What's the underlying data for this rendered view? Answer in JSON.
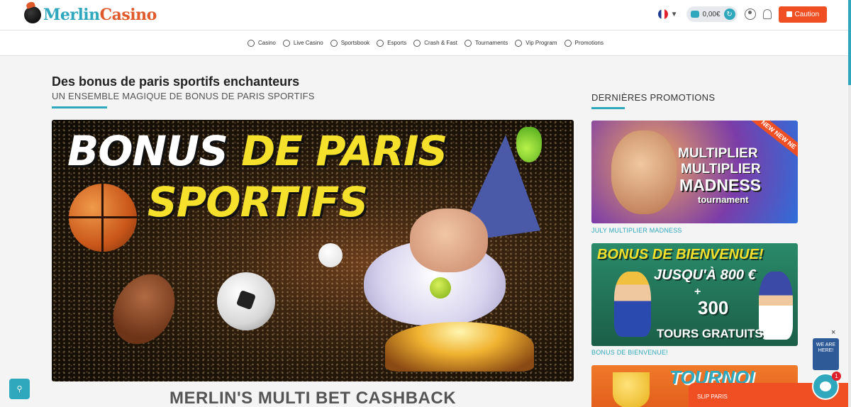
{
  "brand": {
    "part1": "Merlin",
    "part2": "Casino",
    "accent": "#2fa7bd",
    "orange": "#f04e23"
  },
  "header": {
    "language_flag": "flag-fr-icon",
    "balance": "0,00€",
    "deposit_label": "Caution"
  },
  "nav": {
    "items": [
      {
        "label": "Casino",
        "icon": "casino-icon"
      },
      {
        "label": "Live Casino",
        "icon": "live-casino-icon"
      },
      {
        "label": "Sportsbook",
        "icon": "sportsbook-icon"
      },
      {
        "label": "Esports",
        "icon": "esports-icon"
      },
      {
        "label": "Crash & Fast",
        "icon": "crash-fast-icon"
      },
      {
        "label": "Tournaments",
        "icon": "tournaments-icon"
      },
      {
        "label": "Vip Program",
        "icon": "vip-icon"
      },
      {
        "label": "Promotions",
        "icon": "promotions-icon"
      }
    ]
  },
  "main": {
    "title": "Des bonus de paris sportifs enchanteurs",
    "subtitle": "UN ENSEMBLE MAGIQUE DE BONUS DE PARIS SPORTIFS",
    "banner": {
      "line1_white": "BONUS ",
      "line1_yellow": "DE PARIS",
      "line2": "SPORTIFS"
    },
    "section_heading": "MERLIN'S MULTI BET CASHBACK"
  },
  "sidebar": {
    "title": "DERNIÈRES PROMOTIONS",
    "promos": [
      {
        "label": "JULY MULTIPLIER MADNESS",
        "ribbon": "NEW NEW NE",
        "line1": "MULTIPLIER",
        "line2": "MULTIPLIER",
        "line3": "MADNESS",
        "line4": "tournament"
      },
      {
        "label": "BONUS DE BIENVENUE!",
        "line1": "BONUS DE BIENVENUE!",
        "line2": "JUSQU'À 800 €",
        "line3": "+",
        "line4": "300",
        "line5": "TOURS GRATUITS"
      },
      {
        "label": "",
        "line1": "TOURNOI"
      }
    ]
  },
  "widgets": {
    "we_are_here": "WE ARE HERE!",
    "close": "×",
    "slip": "SLIP PARIS",
    "chat_badge": "1"
  }
}
